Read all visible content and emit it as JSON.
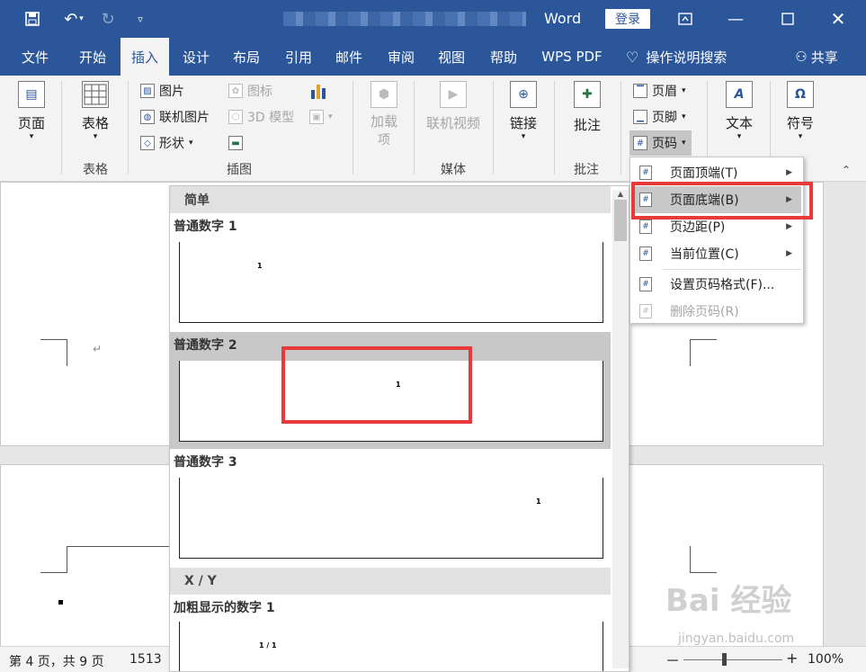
{
  "titlebar": {
    "app_name": "Word",
    "login_label": "登录",
    "save_icon": "save-icon",
    "undo_icon": "undo-icon",
    "redo_icon": "redo-icon",
    "customize_icon": "customize-qat-icon"
  },
  "tabs": [
    "文件",
    "开始",
    "插入",
    "设计",
    "布局",
    "引用",
    "邮件",
    "审阅",
    "视图",
    "帮助",
    "WPS PDF"
  ],
  "active_tab": "插入",
  "tell_me": "操作说明搜索",
  "share": "共享",
  "ribbon": {
    "pages_label": "页面",
    "table_label": "表格",
    "table_group": "表格",
    "picture": "图片",
    "online_picture": "联机图片",
    "shapes": "形状",
    "icons": "图标",
    "model3d": "3D 模型",
    "illustrations_group": "插图",
    "addins_line1": "加载",
    "addins_line2": "项",
    "online_video": "联机视频",
    "media_group": "媒体",
    "link": "链接",
    "comment": "批注",
    "comment_group": "批注",
    "header": "页眉",
    "footer": "页脚",
    "page_number": "页码",
    "text": "文本",
    "symbol": "符号"
  },
  "gallery": {
    "section_simple": "简单",
    "item1": "普通数字 1",
    "item2": "普通数字 2",
    "item3": "普通数字 3",
    "section_xy": "X / Y",
    "item4": "加粗显示的数字 1",
    "num": "1",
    "num_xy": "1 / 1"
  },
  "submenu": {
    "items": [
      {
        "label": "页面顶端(T)",
        "arrow": true,
        "enabled": true
      },
      {
        "label": "页面底端(B)",
        "arrow": true,
        "enabled": true,
        "highlight": true
      },
      {
        "label": "页边距(P)",
        "arrow": true,
        "enabled": true
      },
      {
        "label": "当前位置(C)",
        "arrow": true,
        "enabled": true
      },
      {
        "label": "设置页码格式(F)...",
        "arrow": false,
        "enabled": true
      },
      {
        "label": "删除页码(R)",
        "arrow": false,
        "enabled": false
      }
    ]
  },
  "document": {
    "return_mark": "↵"
  },
  "status": {
    "page_info": "第 4 页，共 9 页",
    "word_count": "1513",
    "zoom": "100%",
    "minus": "－",
    "plus": "+"
  },
  "watermark": {
    "line1": "Bai 经验",
    "line2": "jingyan.baidu.com"
  },
  "colors": {
    "brand": "#2b579a",
    "highlight_box": "#e8393b"
  }
}
